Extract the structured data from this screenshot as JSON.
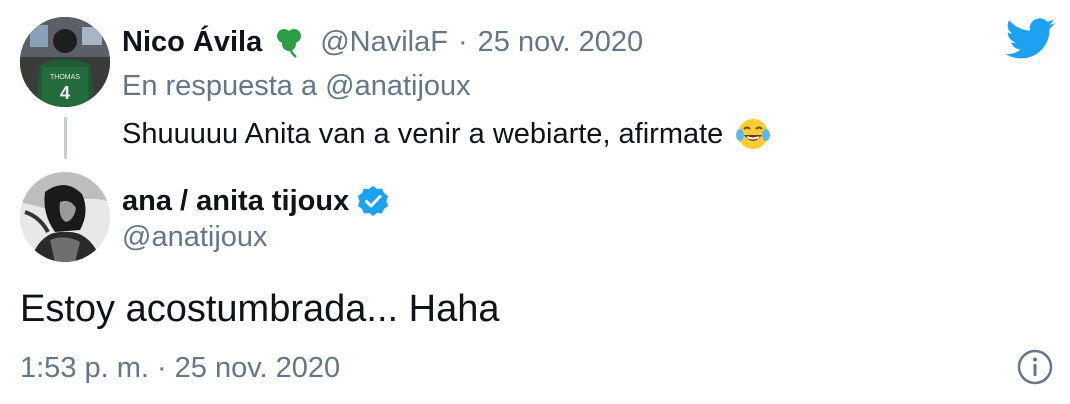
{
  "reply_tweet": {
    "display_name": "Nico Ávila",
    "name_emoji": "shamrock-icon",
    "handle": "@NavilaF",
    "separator": "·",
    "date": "25 nov. 2020",
    "reply_context": "En respuesta a @anatijoux",
    "text": "Shuuuuu Anita van a venir a webiarte, afirmate",
    "text_emoji": "face-with-tears-of-joy-icon",
    "avatar": "avatar",
    "avatar_jersey_text": "THOMAS",
    "avatar_jersey_number": "4"
  },
  "main_tweet": {
    "display_name": "ana / anita tijoux",
    "verified": true,
    "handle": "@anatijoux",
    "text": "Estoy acostumbrada... Haha",
    "time": "1:53 p. m.",
    "separator": "·",
    "date": "25 nov. 2020",
    "avatar": "avatar"
  },
  "icons": {
    "brand": "twitter-bird-icon",
    "info": "info-icon"
  },
  "colors": {
    "brand": "#1da1f2",
    "muted": "#657786",
    "text": "#0f1419",
    "thread_line": "#c4cfd6",
    "shamrock": "#2e9e44"
  }
}
